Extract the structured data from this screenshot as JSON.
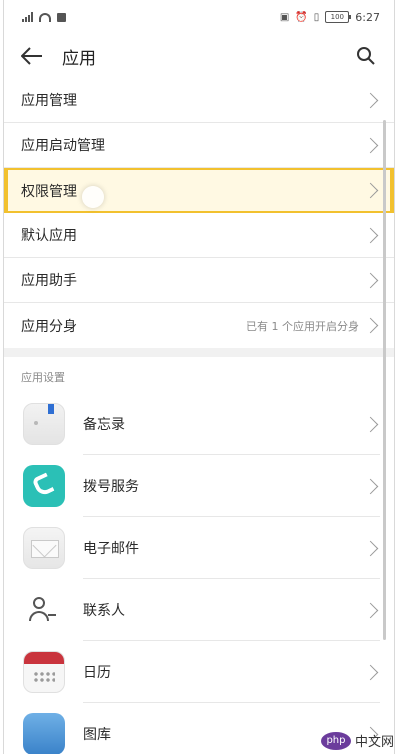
{
  "status_bar": {
    "time": "6:27",
    "battery": "100"
  },
  "header": {
    "title": "应用"
  },
  "menu": [
    {
      "label": "应用管理",
      "sub": "",
      "highlight": false
    },
    {
      "label": "应用启动管理",
      "sub": "",
      "highlight": false
    },
    {
      "label": "权限管理",
      "sub": "",
      "highlight": true
    },
    {
      "label": "默认应用",
      "sub": "",
      "highlight": false
    },
    {
      "label": "应用助手",
      "sub": "",
      "highlight": false
    },
    {
      "label": "应用分身",
      "sub": "已有 1 个应用开启分身",
      "highlight": false
    }
  ],
  "section_title": "应用设置",
  "apps": [
    {
      "label": "备忘录",
      "icon": "memo-icon"
    },
    {
      "label": "拨号服务",
      "icon": "phone-icon"
    },
    {
      "label": "电子邮件",
      "icon": "email-icon"
    },
    {
      "label": "联系人",
      "icon": "contacts-icon"
    },
    {
      "label": "日历",
      "icon": "calendar-icon"
    },
    {
      "label": "图库",
      "icon": "gallery-icon"
    }
  ],
  "watermark": {
    "badge": "php",
    "text": "中文网"
  },
  "colors": {
    "highlight_border": "#f2c12e",
    "phone_icon": "#2bc0b6",
    "calendar_red": "#c9343d",
    "memo_bookmark": "#2f6fd3"
  }
}
